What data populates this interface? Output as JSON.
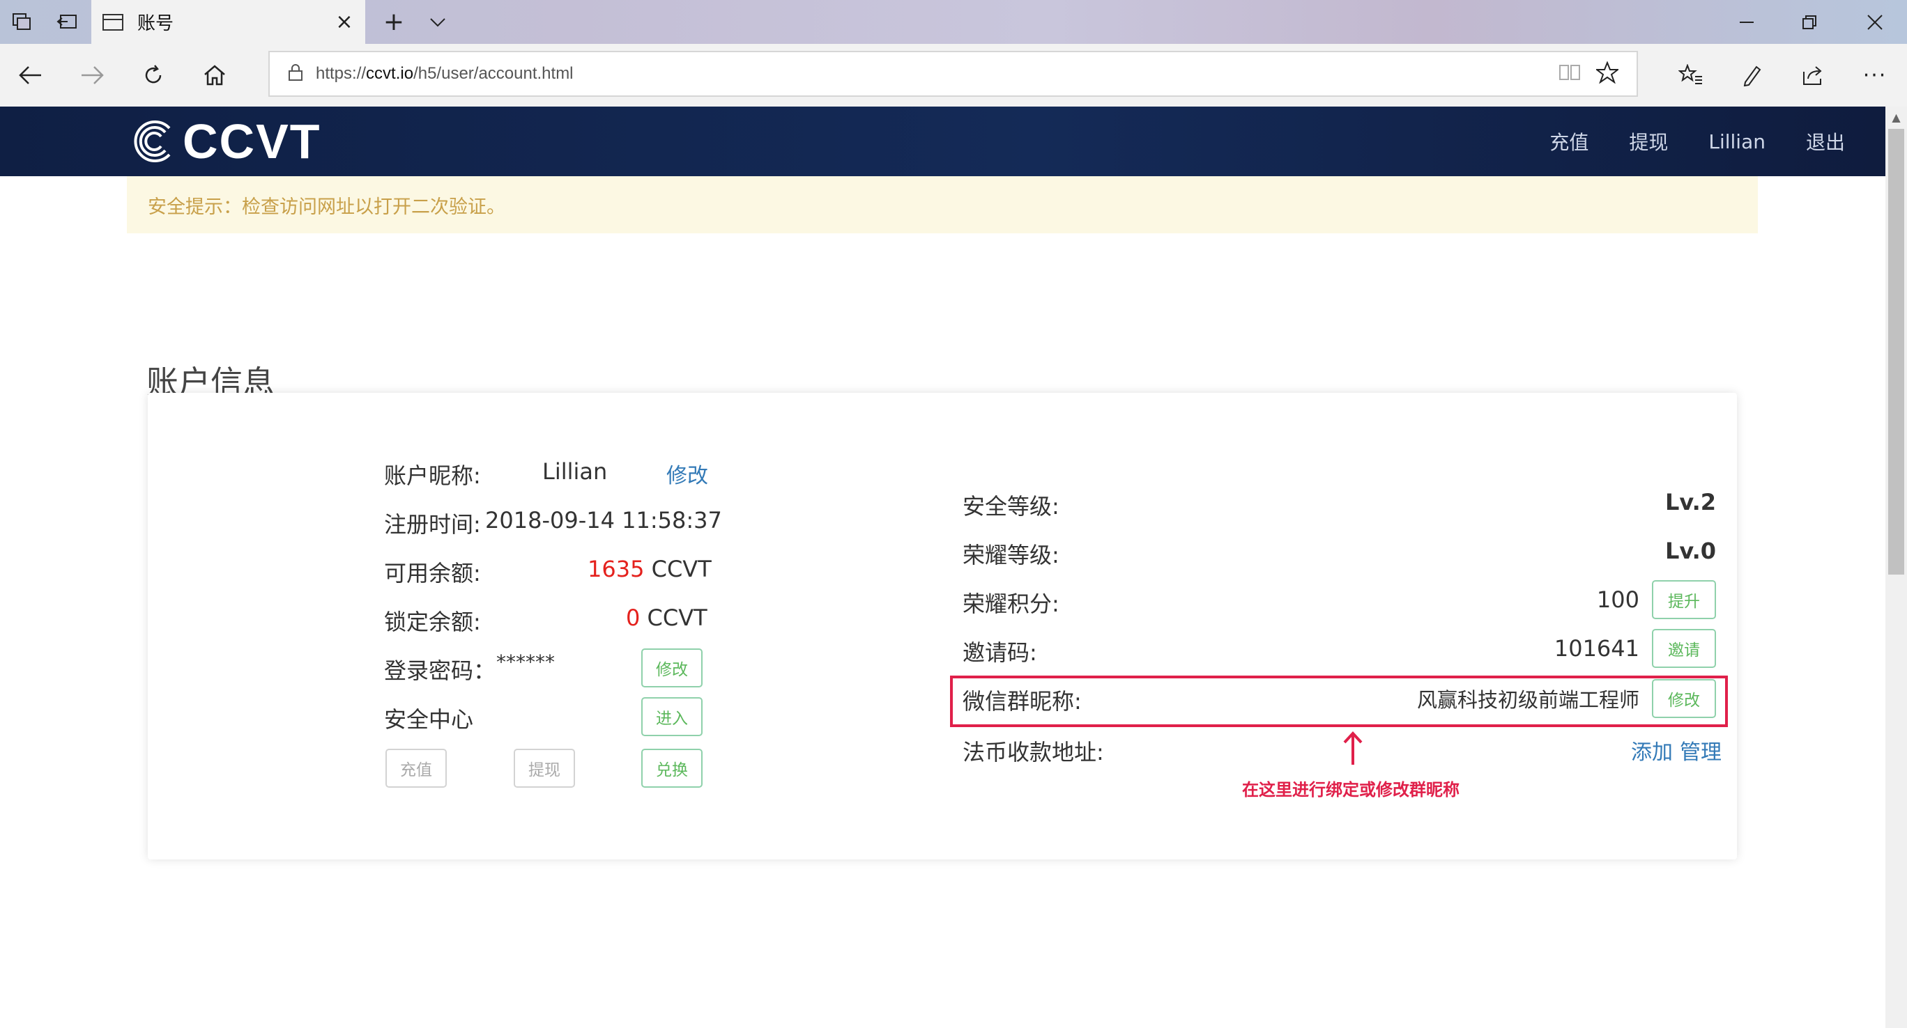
{
  "browser": {
    "tab_title": "账号",
    "url_prefix": "https://",
    "url_host": "ccvt.io",
    "url_path": "/h5/user/account.html",
    "icons": [
      "tab-actions-icon",
      "set-aside-tabs-icon",
      "page-icon",
      "close-icon",
      "new-tab-icon",
      "tab-list-chevron-icon",
      "minimize-icon",
      "restore-icon",
      "window-close-icon",
      "back-icon",
      "forward-icon",
      "refresh-icon",
      "home-icon",
      "lock-icon",
      "reading-view-icon",
      "favorite-star-icon",
      "favorites-list-icon",
      "pen-icon",
      "share-icon",
      "more-icon"
    ]
  },
  "site": {
    "logo": "CCVT",
    "nav": [
      "充值",
      "提现",
      "Lillian",
      "退出"
    ],
    "alert": "安全提示：检查访问网址以打开二次验证。",
    "section_title": "账户信息"
  },
  "left": {
    "nickname_label": "账户昵称:",
    "nickname_value": "Lillian",
    "nickname_edit": "修改",
    "regtime_label": "注册时间:",
    "regtime_value": "2018-09-14 11:58:37",
    "available_label": "可用余额:",
    "available_amount": "1635",
    "available_unit": " CCVT",
    "locked_label": "锁定余额:",
    "locked_amount": "0",
    "locked_unit": " CCVT",
    "password_label": "登录密码：",
    "password_value": "******",
    "password_btn": "修改",
    "security_label": "安全中心",
    "security_btn": "进入",
    "recharge_btn": "充值",
    "withdraw_btn": "提现",
    "exchange_btn": "兑换"
  },
  "right": {
    "security_level_label": "安全等级:",
    "security_level_value": "Lv.2",
    "honor_level_label": "荣耀等级:",
    "honor_level_value": "Lv.0",
    "honor_points_label": "荣耀积分:",
    "honor_points_value": "100",
    "honor_points_btn": "提升",
    "invite_label": "邀请码:",
    "invite_value": "101641",
    "invite_btn": "邀请",
    "wechat_label": "微信群昵称:",
    "wechat_value": "风赢科技初级前端工程师",
    "wechat_btn": "修改",
    "fiat_label": "法币收款地址:",
    "fiat_add": "添加",
    "fiat_manage": "管理"
  },
  "annotation": {
    "text": "在这里进行绑定或修改群昵称",
    "color": "#e0204a"
  },
  "colors": {
    "header_bg": "#142a57",
    "alert_bg": "#fcf8e3",
    "alert_text": "#c8a04a",
    "amount_red": "#e4211d",
    "link_blue": "#337ab7",
    "button_green": "#5cb85c"
  }
}
